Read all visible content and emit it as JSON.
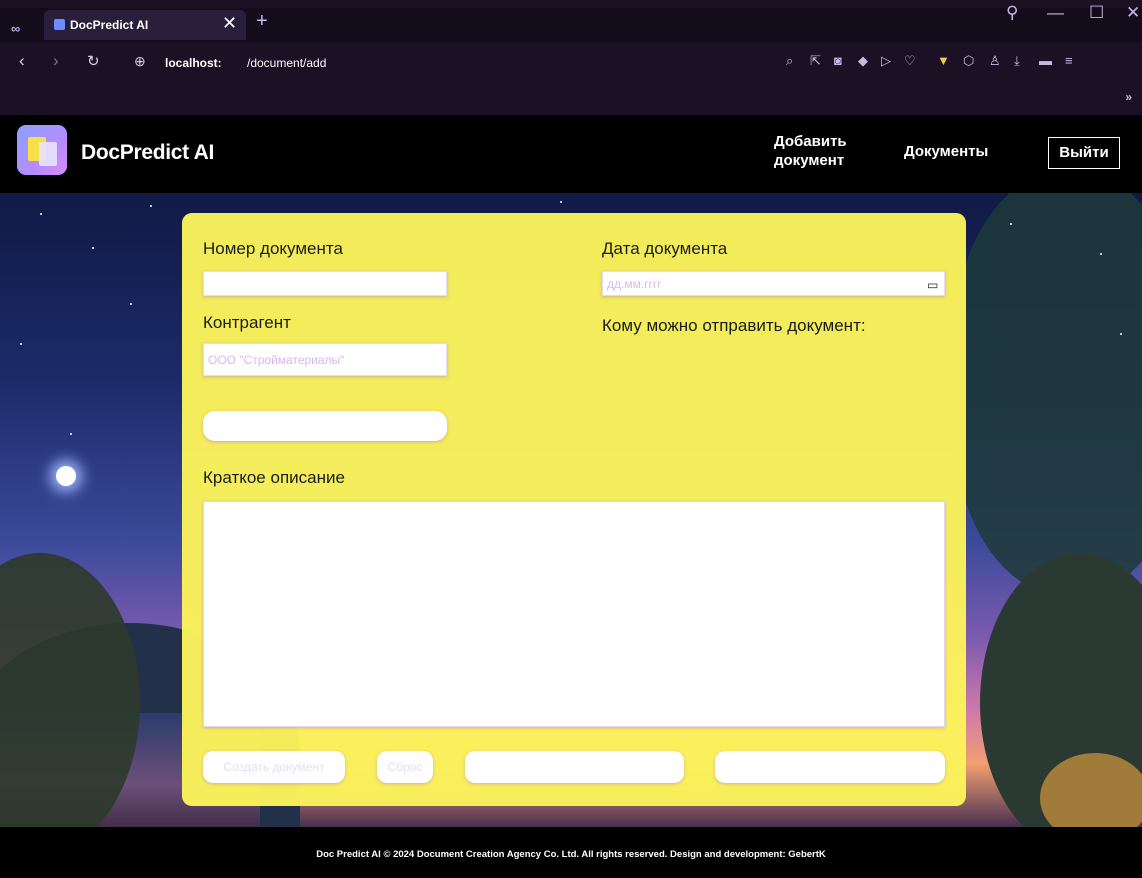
{
  "browser": {
    "tab_title": "DocPredict AI",
    "tab_close": "✕",
    "new_tab": "+",
    "url_host": "localhost:",
    "url_path": "/document/add",
    "overflow_chevron": "»"
  },
  "header": {
    "brand": "DocPredict AI",
    "nav_add_document": "Добавить документ",
    "nav_documents": "Документы",
    "nav_logout": "Выйти"
  },
  "form": {
    "doc_number_label": "Номер документа",
    "doc_number_placeholder": "",
    "doc_date_label": "Дата документа",
    "doc_date_placeholder": "дд.мм.гггг",
    "counterparty_label": "Контрагент",
    "counterparty_placeholder": "ООО \"Стройматериалы\"",
    "recipients_label": "Кому можно отправить документ:",
    "select_button": "",
    "description_label": "Краткое описание",
    "description_placeholder": ""
  },
  "actions": {
    "create": "Создать документ",
    "reset": "Сброс",
    "predict": "",
    "template": ""
  },
  "footer": {
    "text": "Doc Predict AI © 2024 Document Creation Agency Co. Ltd. All rights reserved. Design and development: GebertK"
  },
  "colors": {
    "card_bg": "#fbf35b",
    "header_bg": "#000000",
    "chrome_bg": "#1a1224",
    "field_placeholder": "#d8b8ee"
  }
}
